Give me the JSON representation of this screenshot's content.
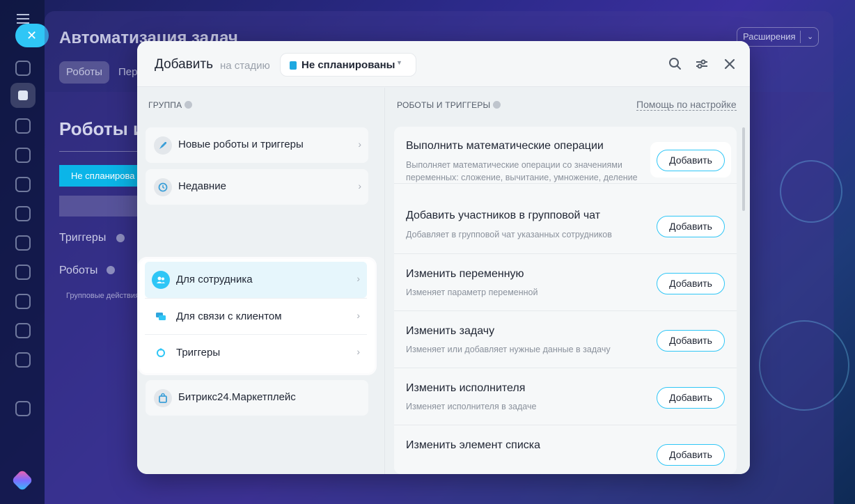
{
  "background": {
    "title": "Автоматизация задач",
    "tabs": [
      "Роботы",
      "Пер"
    ],
    "extensions_label": "Расширения",
    "heading": "Роботы и",
    "stage": "Не спланирова",
    "triggers_label": "Триггеры",
    "robots_label": "Роботы",
    "group_actions": "Групповые действия"
  },
  "dialog": {
    "title": "Добавить",
    "stage_prefix": "на стадию",
    "stage_value": "Не спланированы",
    "accent_color": "#2fc6f6",
    "header_icons": [
      "search-icon",
      "filter-icon",
      "close-icon"
    ],
    "group_label": "ГРУППА",
    "robots_label": "РОБОТЫ И ТРИГГЕРЫ",
    "help_link": "Помощь по настройке",
    "groups": [
      {
        "label": "Новые роботы и триггеры",
        "icon": "rocket-icon"
      },
      {
        "label": "Недавние",
        "icon": "history-icon"
      },
      {
        "label": "Для сотрудника",
        "icon": "users-icon",
        "selected": true
      },
      {
        "label": "Для связи с клиентом",
        "icon": "chat-icon"
      },
      {
        "label": "Триггеры",
        "icon": "trigger-icon"
      },
      {
        "label": "Битрикс24.Маркетплейс",
        "icon": "market-icon"
      }
    ],
    "items": [
      {
        "title": "Выполнить математические операции",
        "desc": "Выполняет математические операции со значениями переменных: сложение, вычитание, умножение, деление",
        "button": "Добавить"
      },
      {
        "title": "Добавить участников в групповой чат",
        "desc": "Добавляет в групповой чат указанных сотрудников",
        "button": "Добавить"
      },
      {
        "title": "Изменить переменную",
        "desc": "Изменяет параметр переменной",
        "button": "Добавить"
      },
      {
        "title": "Изменить задачу",
        "desc": "Изменяет или добавляет нужные данные в задачу",
        "button": "Добавить"
      },
      {
        "title": "Изменить исполнителя",
        "desc": "Изменяет исполнителя в задаче",
        "button": "Добавить"
      },
      {
        "title": "Изменить элемент списка",
        "desc": "",
        "button": "Добавить"
      }
    ]
  }
}
